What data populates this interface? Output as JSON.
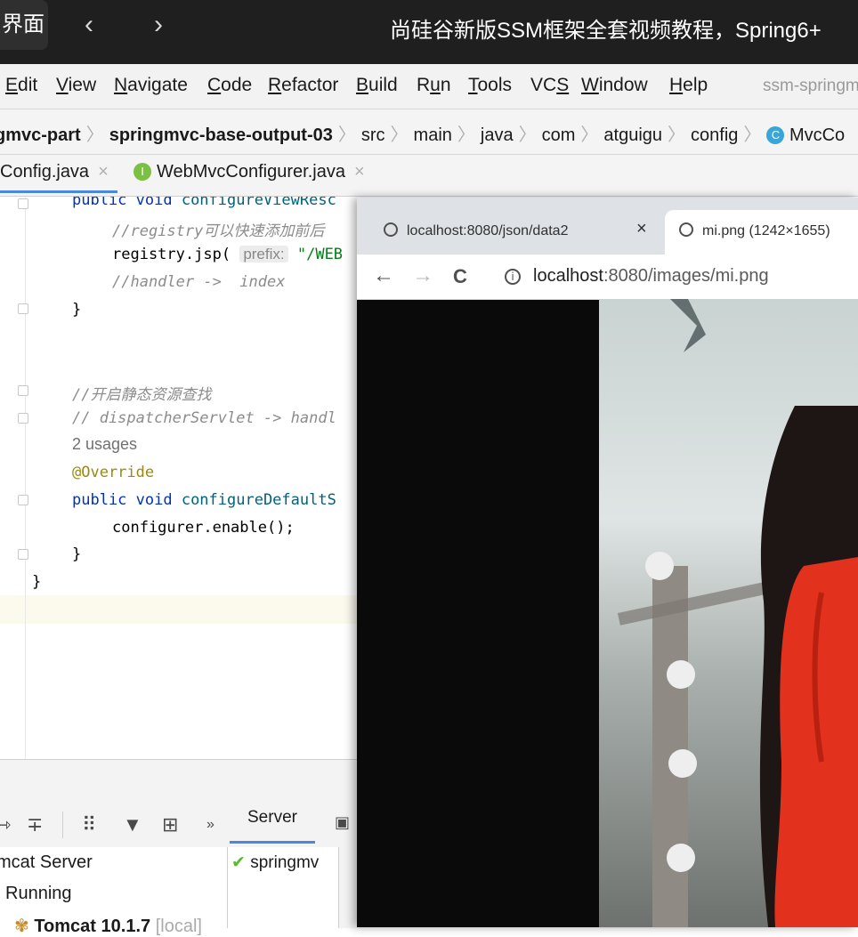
{
  "top_bar": {
    "back_label": "界面",
    "prev_arrow": "‹",
    "next_arrow": "›",
    "title": "尚硅谷新版SSM框架全套视频教程，Spring6+"
  },
  "menu": {
    "items": [
      {
        "pre": "",
        "u": "E",
        "post": "dit"
      },
      {
        "pre": "",
        "u": "V",
        "post": "iew"
      },
      {
        "pre": "",
        "u": "N",
        "post": "avigate"
      },
      {
        "pre": "",
        "u": "C",
        "post": "ode"
      },
      {
        "pre": "",
        "u": "R",
        "post": "efactor"
      },
      {
        "pre": "",
        "u": "B",
        "post": "uild"
      },
      {
        "pre": "R",
        "u": "u",
        "post": "n"
      },
      {
        "pre": "",
        "u": "T",
        "post": "ools"
      },
      {
        "pre": "VC",
        "u": "S",
        "post": ""
      },
      {
        "pre": "",
        "u": "W",
        "post": "indow"
      },
      {
        "pre": "",
        "u": "H",
        "post": "elp"
      }
    ],
    "project": "ssm-springm"
  },
  "breadcrumb": {
    "module": "gmvc-part",
    "project": "springmvc-base-output-03",
    "src": "src",
    "main": "main",
    "java": "java",
    "com": "com",
    "atguigu": "atguigu",
    "config": "config",
    "class_badge": "C",
    "class_name": "MvcCo"
  },
  "tabs": {
    "file1": "Config.java",
    "file2_badge": "I",
    "file2": "WebMvcConfigurer.java",
    "close": "×"
  },
  "code": {
    "l1_kw": "public void ",
    "l1_fn": "configureViewResc",
    "l2": "//registry可以快速添加前后",
    "l3_a": "registry.jsp(",
    "l3_hint": "prefix:",
    "l3_str": "\"/WEB",
    "l4": "//handler ->  index",
    "l5": "}",
    "l6": "//开启静态资源查找",
    "l7": "// dispatcherServlet -> handl",
    "usages": "2 usages",
    "l8": "@Override",
    "l9_kw": "public void ",
    "l9_fn": "configureDefaultS",
    "l10": "configurer.enable();",
    "l11": "}",
    "l12": "}"
  },
  "bottom_panel": {
    "server_tab": "Server",
    "tree_server": "mcat Server",
    "tree_running": "Running",
    "tree_tomcat": "Tomcat 10.1.7",
    "tree_tomcat_tag": "[local]",
    "deploy_item": "springmv"
  },
  "browser": {
    "tab1_title": "localhost:8080/json/data2",
    "tab1_close": "×",
    "tab2_title": "mi.png (1242×1655)",
    "url_host": "localhost",
    "url_rest": ":8080/images/mi.png",
    "back": "←",
    "forward": "→",
    "reload": "C",
    "info": "i"
  }
}
